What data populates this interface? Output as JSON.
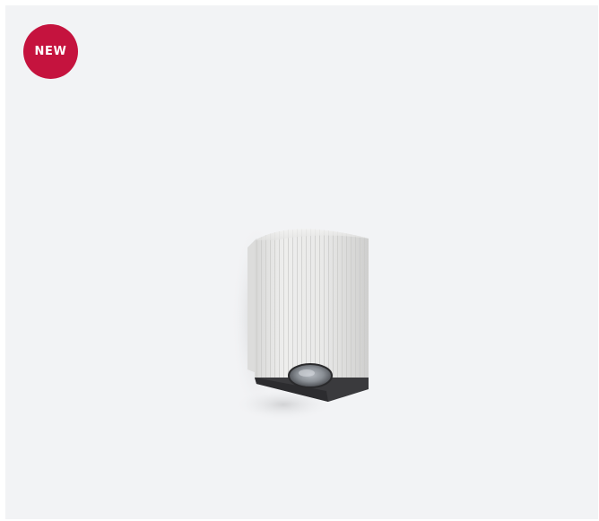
{
  "badge": {
    "label": "NEW",
    "color": "#c5133e"
  },
  "product_image": {
    "icon": "wall-light-fixture-icon",
    "body_color": "#e7e7e6",
    "base_color": "#3a3a3d",
    "background_color": "#f2f3f5"
  }
}
